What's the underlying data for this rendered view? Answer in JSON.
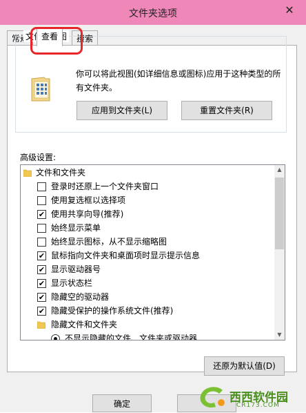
{
  "window": {
    "title": "文件夹选项",
    "close_glyph": "✕"
  },
  "tabs": [
    {
      "label": "常规"
    },
    {
      "label": "查看"
    },
    {
      "label": "搜索"
    }
  ],
  "folder_views": {
    "group_title": "文件夹视图",
    "description_line1": "你可以将此视图(如详细信息或图标)应用于这种类型的所",
    "description_line2": "有文件夹。",
    "apply_button": "应用到文件夹(L)",
    "reset_button": "重置文件夹(R)"
  },
  "advanced": {
    "label": "高级设置:",
    "tree": [
      {
        "type": "folder",
        "label": "文件和文件夹"
      },
      {
        "type": "checkbox",
        "label": "登录时还原上一个文件夹窗口",
        "checked": false
      },
      {
        "type": "checkbox",
        "label": "使用复选框以选择项",
        "checked": false
      },
      {
        "type": "checkbox",
        "label": "使用共享向导(推荐)",
        "checked": true
      },
      {
        "type": "checkbox",
        "label": "始终显示菜单",
        "checked": false
      },
      {
        "type": "checkbox",
        "label": "始终显示图标，从不显示缩略图",
        "checked": false
      },
      {
        "type": "checkbox",
        "label": "鼠标指向文件夹和桌面项时显示提示信息",
        "checked": true
      },
      {
        "type": "checkbox",
        "label": "显示驱动器号",
        "checked": true
      },
      {
        "type": "checkbox",
        "label": "显示状态栏",
        "checked": true
      },
      {
        "type": "checkbox",
        "label": "隐藏空的驱动器",
        "checked": true
      },
      {
        "type": "checkbox",
        "label": "隐藏受保护的操作系统文件(推荐)",
        "checked": true
      },
      {
        "type": "folder",
        "label": "隐藏文件和文件夹"
      },
      {
        "type": "radio",
        "label": "不显示隐藏的文件、文件夹或驱动器",
        "checked": true
      }
    ],
    "check_glyph": "✔",
    "restore_button": "还原为默认值(D)"
  },
  "footer": {
    "ok_button": "确定"
  },
  "watermark": {
    "brand": "西西软件园",
    "url": "CR173.COM"
  }
}
